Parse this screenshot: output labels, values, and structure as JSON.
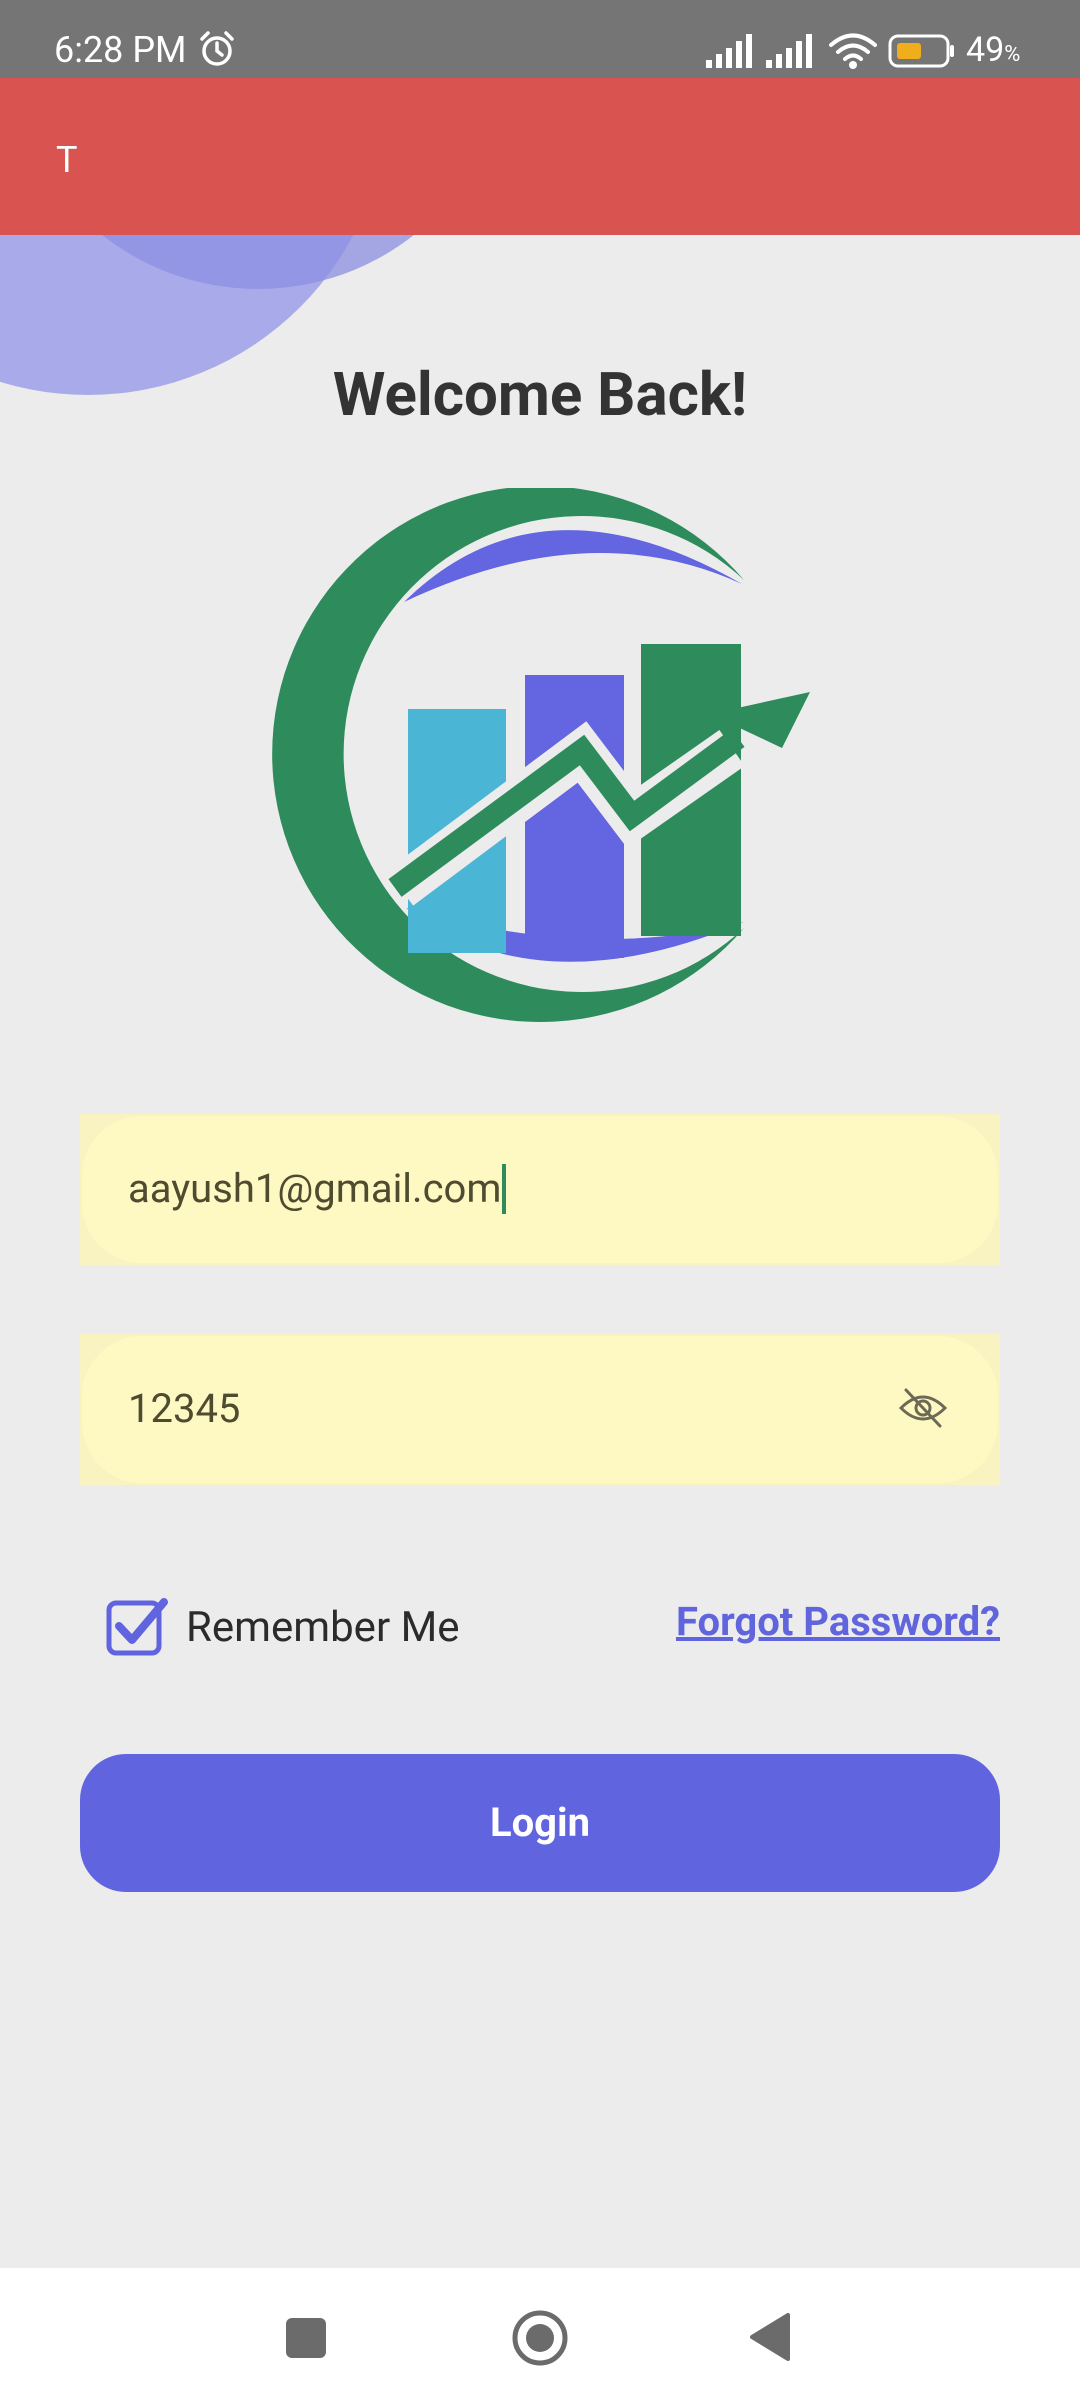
{
  "status_bar": {
    "time": "6:28 PM",
    "battery_percent": "49",
    "battery_unit": "%",
    "icons": [
      "alarm-icon",
      "signal-icon",
      "signal-icon",
      "wifi-icon",
      "battery-icon"
    ]
  },
  "app_bar": {
    "title": "T"
  },
  "login": {
    "heading": "Welcome Back!",
    "email_value": "aayush1@gmail.com",
    "password_value": "12345",
    "remember_label": "Remember Me",
    "remember_checked": true,
    "forgot_label": "Forgot Password?",
    "login_label": "Login"
  },
  "colors": {
    "app_bar": "#d95350",
    "accent": "#6065df",
    "logo_green": "#2e8b5b",
    "logo_blue": "#6366e0",
    "logo_cyan": "#4bb5d6",
    "field_bg": "#fef9c3"
  }
}
